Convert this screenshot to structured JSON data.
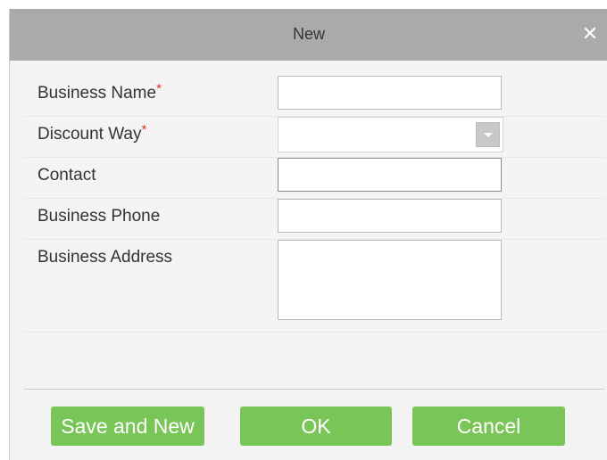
{
  "dialog": {
    "title": "New",
    "close_symbol": "✕"
  },
  "form": {
    "business_name": {
      "label": "Business Name",
      "required_mark": "*",
      "value": ""
    },
    "discount_way": {
      "label": "Discount Way",
      "required_mark": "*",
      "value": ""
    },
    "contact": {
      "label": "Contact",
      "value": ""
    },
    "business_phone": {
      "label": "Business Phone",
      "value": ""
    },
    "business_address": {
      "label": "Business Address",
      "value": ""
    }
  },
  "buttons": {
    "save_and_new": "Save and New",
    "ok": "OK",
    "cancel": "Cancel"
  },
  "colors": {
    "title_bar": "#a9abab",
    "button_green": "#7ac558",
    "required_red": "#e0302a"
  }
}
